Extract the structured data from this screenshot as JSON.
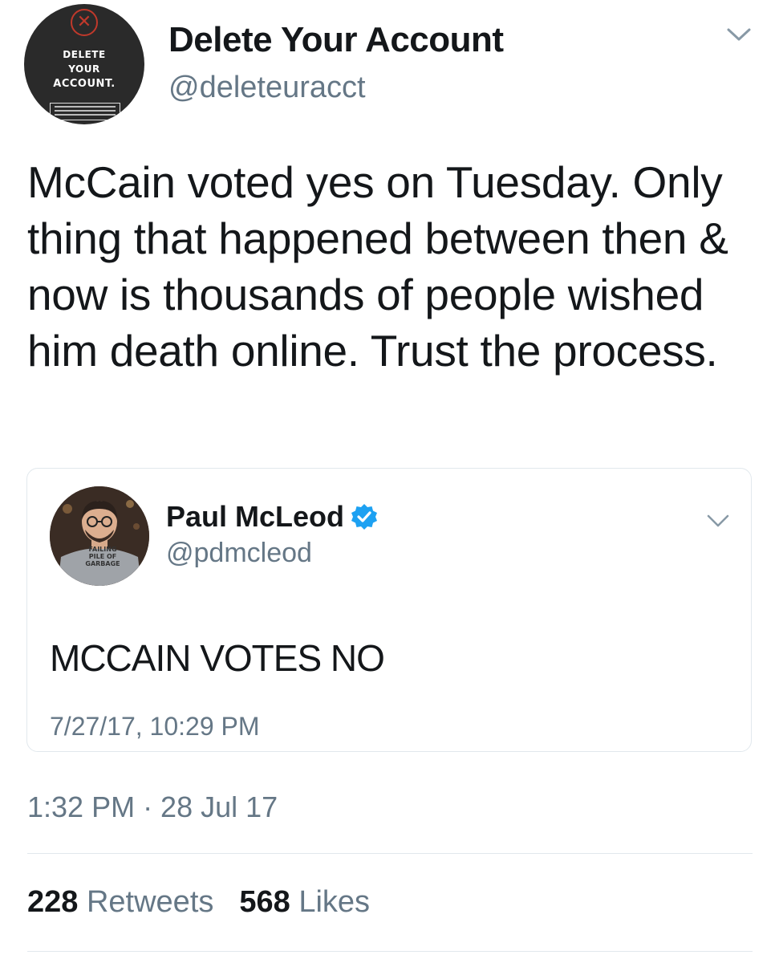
{
  "author": {
    "display_name": "Delete Your Account",
    "handle": "@deleteuracct",
    "avatar_logo": {
      "line1": "DELETE",
      "line2": "YOUR",
      "line3": "ACCOUNT."
    }
  },
  "tweet": {
    "text": "McCain voted yes on Tuesday. Only thing that happened between then & now is thousands of people wished him death online. Trust the process.",
    "timestamp": "1:32 PM · 28 Jul 17"
  },
  "quoted_tweet": {
    "display_name": "Paul McLeod",
    "handle": "@pdmcleod",
    "verified": true,
    "text": "MCCAIN VOTES NO",
    "timestamp": "7/27/17, 10:29 PM",
    "avatar_shirt_text": [
      "FAILING",
      "PILE OF",
      "GARBAGE"
    ]
  },
  "stats": {
    "retweets_count": "228",
    "retweets_label": "Retweets",
    "likes_count": "568",
    "likes_label": "Likes"
  },
  "icons": {
    "caret": "chevron-down-icon",
    "verified": "verified-badge-icon"
  },
  "colors": {
    "primary_text": "#14171a",
    "secondary_text": "#657786",
    "verified_blue": "#1da1f2",
    "divider": "#e1e8ed"
  }
}
